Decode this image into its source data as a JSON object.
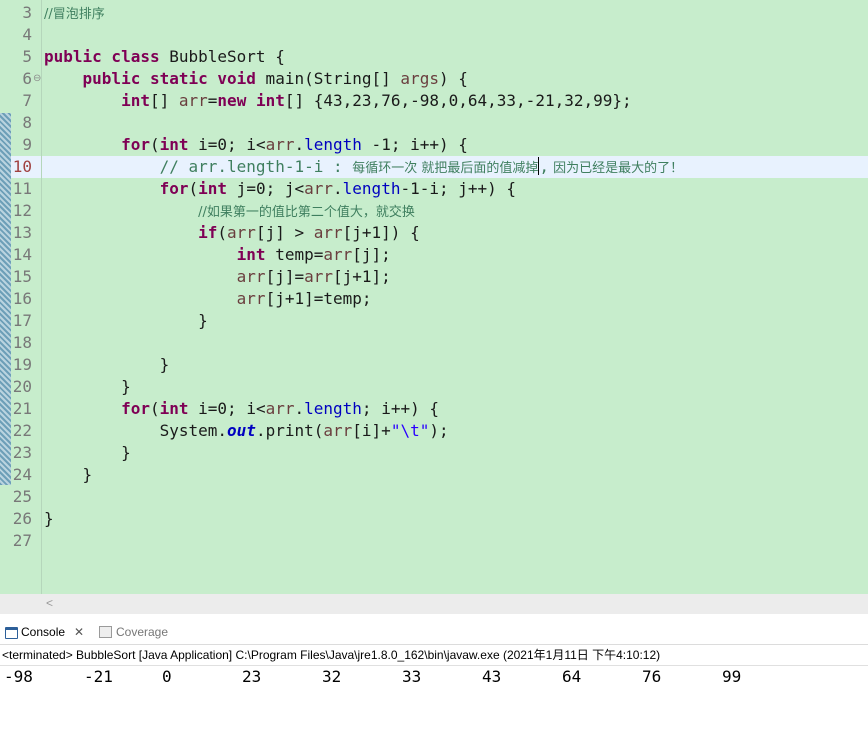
{
  "editor": {
    "line_numbers": [
      "3",
      "4",
      "5",
      "6",
      "7",
      "8",
      "9",
      "10",
      "11",
      "12",
      "13",
      "14",
      "15",
      "16",
      "17",
      "18",
      "19",
      "20",
      "21",
      "22",
      "23",
      "24",
      "25",
      "26",
      "27"
    ],
    "tokens": {
      "l3": "//冒泡排序",
      "l5_kw": "public class",
      "l5_rest": " BubbleSort {",
      "l6_kw": "public static void",
      "l6_a": " main(String[] ",
      "l6_var": "args",
      "l6_b": ") {",
      "l7_kw1": "int",
      "l7_a": "[] ",
      "l7_var": "arr",
      "l7_eq": "=",
      "l7_kw2": "new int",
      "l7_b": "[] {43,23,76,-98,0,64,33,-21,32,99};",
      "l9_kw1": "for",
      "l9_p": "(",
      "l9_kw2": "int",
      "l9_a": " i=0; i<",
      "l9_var": "arr",
      "l9_dot": ".",
      "l9_fld": "length",
      "l9_b": " -1; i++) {",
      "l10_cm": "// arr.length-1-i : ",
      "l10_cjk1": "每循环一次 就把最后面的值减掉",
      "l10_cm2": ",",
      "l10_cjk2": " 因为已经是最大的了！",
      "l11_kw1": "for",
      "l11_p": "(",
      "l11_kw2": "int",
      "l11_a": " j=0; j<",
      "l11_var": "arr",
      "l11_dot": ".",
      "l11_fld": "length",
      "l11_b": "-1-i; j++) {",
      "l12_cm": "//如果第一的值比第二个值大，就交换",
      "l13_kw": "if",
      "l13_a": "(",
      "l13_v1": "arr",
      "l13_b": "[j] > ",
      "l13_v2": "arr",
      "l13_c": "[j+1]) {",
      "l14_kw": "int",
      "l14_a": " temp=",
      "l14_var": "arr",
      "l14_b": "[j];",
      "l15_v1": "arr",
      "l15_a": "[j]=",
      "l15_v2": "arr",
      "l15_b": "[j+1];",
      "l16_var": "arr",
      "l16_a": "[j+1]=temp;",
      "l17": "}",
      "l19": "}",
      "l20": "}",
      "l21_kw1": "for",
      "l21_p": "(",
      "l21_kw2": "int",
      "l21_a": " i=0; i<",
      "l21_var": "arr",
      "l21_dot": ".",
      "l21_fld": "length",
      "l21_b": "; i++) {",
      "l22_a": "System.",
      "l22_st": "out",
      "l22_b": ".print(",
      "l22_var": "arr",
      "l22_c": "[i]+",
      "l22_str": "\"\\t\"",
      "l22_d": ");",
      "l23": "}",
      "l24": "}",
      "l26": "}"
    }
  },
  "console": {
    "tabs": [
      {
        "label": "Console",
        "icon": "console-icon",
        "active": true
      },
      {
        "label": "Coverage",
        "icon": "coverage-icon",
        "active": false
      }
    ],
    "close_glyph": "✕",
    "status": "<terminated> BubbleSort [Java Application] C:\\Program Files\\Java\\jre1.8.0_162\\bin\\javaw.exe (2021年1月11日 下午4:10:12)",
    "output": [
      "-98",
      "-21",
      "0",
      "23",
      "32",
      "33",
      "43",
      "64",
      "76",
      "99"
    ]
  },
  "colors": {
    "editor_bg": "#c7edcc",
    "keyword": "#7f0055",
    "field": "#0000c0",
    "comment": "#3f7f5f",
    "string": "#2a00ff"
  }
}
